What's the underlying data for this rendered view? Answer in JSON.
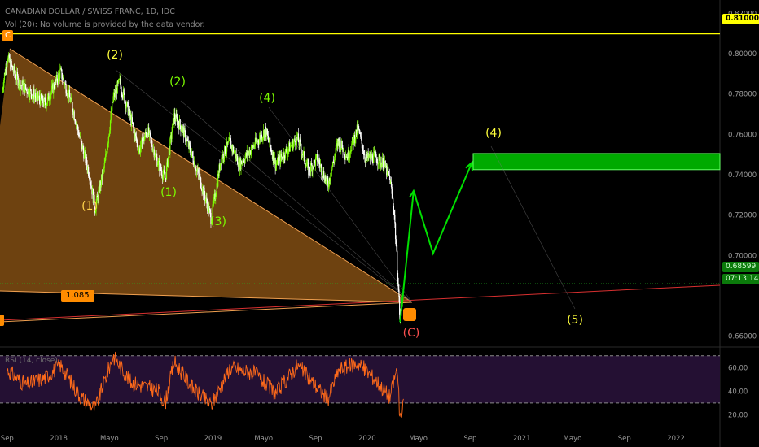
{
  "header": {
    "title": "CANADIAN DOLLAR / SWISS FRANC, 1D, IDC",
    "volume_note": "Vol (20): No volume is provided by the data vendor."
  },
  "price_axis": {
    "labels": [
      "0.82000",
      "0.80000",
      "0.78000",
      "0.76000",
      "0.74000",
      "0.72000",
      "0.70000",
      "0.66000"
    ],
    "highlight_label": "0.81000",
    "current_price": "0.68599",
    "countdown": "07:13:14"
  },
  "time_axis": {
    "labels": [
      "Sep",
      "2018",
      "Mayo",
      "Sep",
      "2019",
      "Mayo",
      "Sep",
      "2020",
      "Mayo",
      "Sep",
      "2021",
      "Mayo",
      "Sep",
      "2022"
    ]
  },
  "rsi": {
    "title": "RSI (14, close)",
    "labels": [
      "60.00",
      "40.00",
      "20.00"
    ]
  },
  "badges": {
    "c_top": "C",
    "fib": "1.085"
  },
  "wave_labels": {
    "w2_top": "(2)",
    "w1_a": "(1)",
    "w2_green": "(2)",
    "w1_b": "(1)",
    "w3": "(3)",
    "w4_green": "(4)",
    "w4_target": "(4)",
    "w5_target": "(5)",
    "c_red": "(C)"
  },
  "colors": {
    "background": "#000000",
    "candles_up": "#7CFC00",
    "candles_down": "#ffffff",
    "resistance_line": "#ffff00",
    "target_zone": "#00c800",
    "triangle_fill": "#c8781e",
    "projection": "#00e000",
    "rsi_line": "#ff6a1a",
    "rsi_band": "#241033",
    "trendline": "#d93030"
  },
  "chart_data": {
    "type": "candlestick",
    "symbol": "CADCHF",
    "timeframe": "1D",
    "ylim": [
      0.655,
      0.825
    ],
    "resistance_level": 0.81,
    "current_price": 0.68599,
    "target_zone": [
      0.7425,
      0.7505
    ],
    "x_range": [
      "2017-08-15",
      "2022-04-15"
    ],
    "price_path": [
      {
        "date": "2017-08-20",
        "close": 0.782
      },
      {
        "date": "2017-09-01",
        "close": 0.798
      },
      {
        "date": "2017-10-01",
        "close": 0.785
      },
      {
        "date": "2017-11-01",
        "close": 0.78
      },
      {
        "date": "2017-12-01",
        "close": 0.775
      },
      {
        "date": "2018-01-05",
        "close": 0.791
      },
      {
        "date": "2018-02-01",
        "close": 0.775
      },
      {
        "date": "2018-02-20",
        "close": 0.758
      },
      {
        "date": "2018-03-15",
        "close": 0.74
      },
      {
        "date": "2018-03-28",
        "close": 0.723
      },
      {
        "date": "2018-04-20",
        "close": 0.745
      },
      {
        "date": "2018-05-10",
        "close": 0.778
      },
      {
        "date": "2018-05-25",
        "close": 0.786
      },
      {
        "date": "2018-06-20",
        "close": 0.768
      },
      {
        "date": "2018-07-10",
        "close": 0.752
      },
      {
        "date": "2018-07-30",
        "close": 0.762
      },
      {
        "date": "2018-08-25",
        "close": 0.745
      },
      {
        "date": "2018-09-10",
        "close": 0.738
      },
      {
        "date": "2018-10-01",
        "close": 0.769
      },
      {
        "date": "2018-10-20",
        "close": 0.763
      },
      {
        "date": "2018-11-15",
        "close": 0.748
      },
      {
        "date": "2018-12-05",
        "close": 0.735
      },
      {
        "date": "2018-12-28",
        "close": 0.718
      },
      {
        "date": "2019-01-20",
        "close": 0.748
      },
      {
        "date": "2019-02-10",
        "close": 0.756
      },
      {
        "date": "2019-03-05",
        "close": 0.745
      },
      {
        "date": "2019-04-10",
        "close": 0.755
      },
      {
        "date": "2019-05-05",
        "close": 0.762
      },
      {
        "date": "2019-05-30",
        "close": 0.745
      },
      {
        "date": "2019-06-25",
        "close": 0.752
      },
      {
        "date": "2019-07-20",
        "close": 0.758
      },
      {
        "date": "2019-08-15",
        "close": 0.742
      },
      {
        "date": "2019-09-05",
        "close": 0.748
      },
      {
        "date": "2019-09-30",
        "close": 0.735
      },
      {
        "date": "2019-10-25",
        "close": 0.757
      },
      {
        "date": "2019-11-15",
        "close": 0.749
      },
      {
        "date": "2019-12-10",
        "close": 0.763
      },
      {
        "date": "2019-12-28",
        "close": 0.748
      },
      {
        "date": "2020-01-20",
        "close": 0.749
      },
      {
        "date": "2020-02-10",
        "close": 0.745
      },
      {
        "date": "2020-02-24",
        "close": 0.738
      },
      {
        "date": "2020-03-05",
        "close": 0.721
      },
      {
        "date": "2020-03-12",
        "close": 0.695
      },
      {
        "date": "2020-03-19",
        "close": 0.667
      },
      {
        "date": "2020-03-27",
        "close": 0.686
      }
    ],
    "projection": [
      {
        "date": "2020-03-19",
        "value": 0.667
      },
      {
        "date": "2020-04-20",
        "value": 0.732
      },
      {
        "date": "2020-06-05",
        "value": 0.701
      },
      {
        "date": "2020-09-05",
        "value": 0.746
      }
    ],
    "rsi": {
      "levels": [
        70,
        30
      ],
      "ylim": [
        12,
        74
      ],
      "path": [
        {
          "date": "2017-09-01",
          "value": 58
        },
        {
          "date": "2017-10-15",
          "value": 45
        },
        {
          "date": "2017-12-01",
          "value": 52
        },
        {
          "date": "2018-01-05",
          "value": 62
        },
        {
          "date": "2018-02-20",
          "value": 36
        },
        {
          "date": "2018-03-28",
          "value": 25
        },
        {
          "date": "2018-05-10",
          "value": 70
        },
        {
          "date": "2018-06-20",
          "value": 48
        },
        {
          "date": "2018-08-25",
          "value": 40
        },
        {
          "date": "2018-09-10",
          "value": 30
        },
        {
          "date": "2018-10-01",
          "value": 65
        },
        {
          "date": "2018-11-15",
          "value": 42
        },
        {
          "date": "2018-12-28",
          "value": 28
        },
        {
          "date": "2019-02-10",
          "value": 60
        },
        {
          "date": "2019-04-10",
          "value": 55
        },
        {
          "date": "2019-05-30",
          "value": 38
        },
        {
          "date": "2019-07-20",
          "value": 62
        },
        {
          "date": "2019-09-30",
          "value": 33
        },
        {
          "date": "2019-10-25",
          "value": 58
        },
        {
          "date": "2019-12-10",
          "value": 64
        },
        {
          "date": "2020-01-20",
          "value": 50
        },
        {
          "date": "2020-02-24",
          "value": 35
        },
        {
          "date": "2020-03-12",
          "value": 60
        },
        {
          "date": "2020-03-19",
          "value": 14
        },
        {
          "date": "2020-03-27",
          "value": 28
        }
      ]
    }
  }
}
